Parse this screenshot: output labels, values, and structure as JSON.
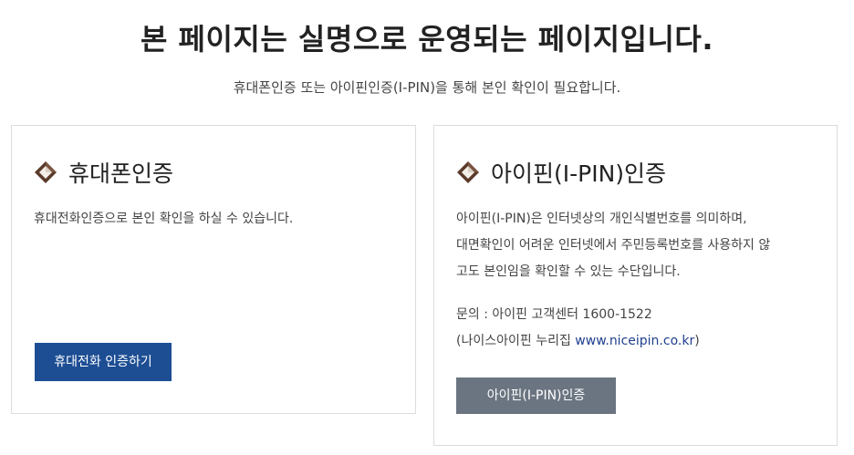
{
  "header": {
    "title": "본 페이지는 실명으로 운영되는 페이지입니다.",
    "subtitle": "휴대폰인증 또는 아이핀인증(I-PIN)을 통해 본인 확인이 필요합니다."
  },
  "phone_card": {
    "icon": "diamond-icon",
    "title": "휴대폰인증",
    "description": "휴대전화인증으로 본인 확인을 하실 수 있습니다.",
    "button_label": "휴대전화 인증하기",
    "button_color": "#1d4e94"
  },
  "ipin_card": {
    "icon": "diamond-icon",
    "title": "아이핀(I-PIN)인증",
    "description_lines": [
      "아이핀(I-PIN)은 인터넷상의 개인식별번호를 의미하며,",
      "대면확인이 어려운 인터넷에서 주민등록번호를 사용하지 않",
      "고도 본인임을 확인할 수 있는 수단입니다."
    ],
    "contact_prefix": "문의 : 아이핀 고객센터  1600-1522",
    "contact_line2_prefix": "(나이스아이핀 누리집 ",
    "contact_link": "www.niceipin.co.kr",
    "contact_line2_suffix": ")",
    "button_label": "아이핀(I-PIN)인증",
    "button_color": "#6b7581"
  }
}
